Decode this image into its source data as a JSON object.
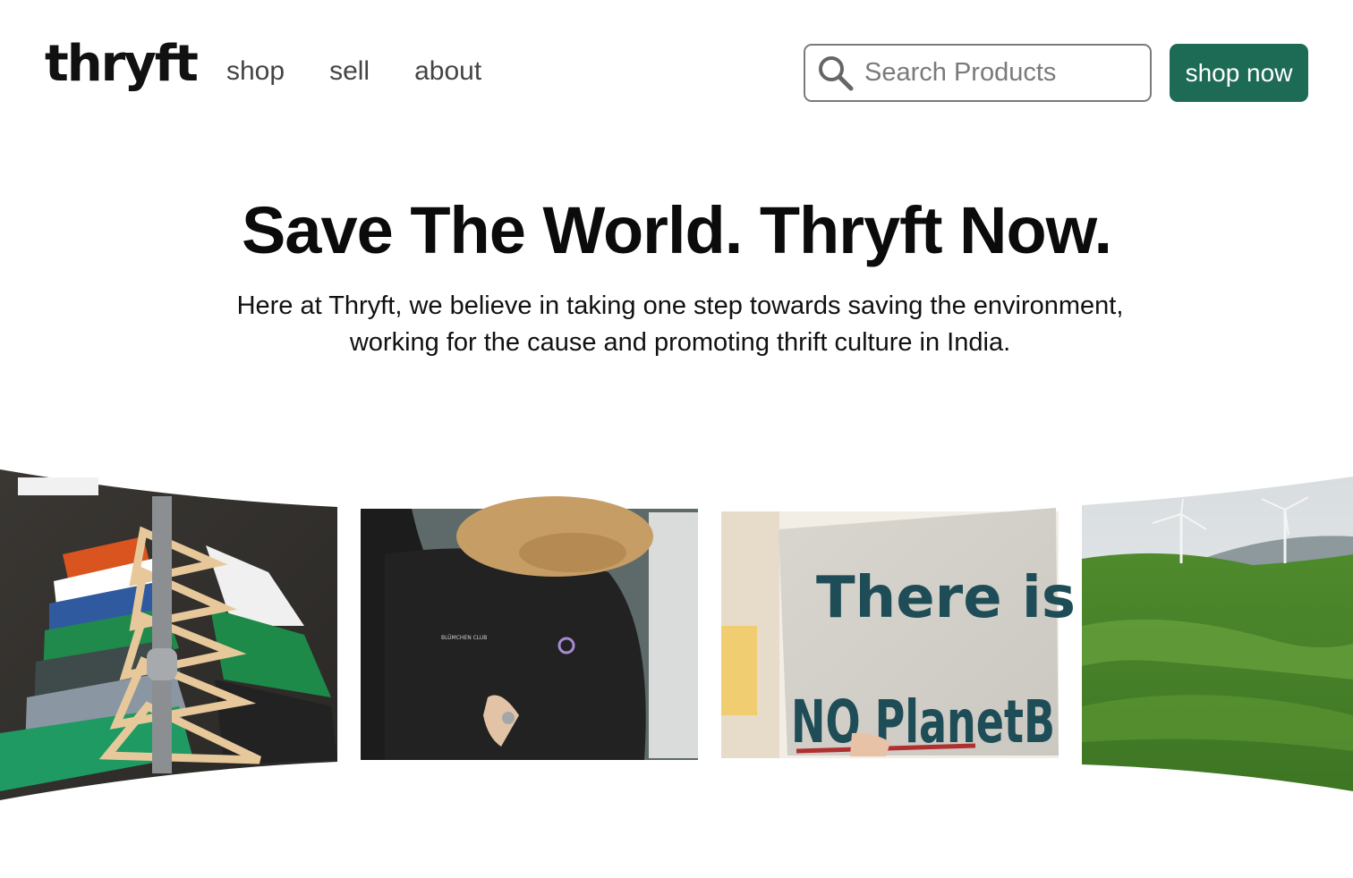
{
  "header": {
    "logo": "thryft",
    "nav": [
      {
        "label": "shop"
      },
      {
        "label": "sell"
      },
      {
        "label": "about"
      }
    ],
    "search": {
      "placeholder": "Search Products",
      "value": ""
    },
    "cta_label": "shop now"
  },
  "hero": {
    "title": "Save The World. Thryft Now.",
    "subtitle_line1": "Here at Thryft, we believe in taking one step towards saving the environment,",
    "subtitle_line2": "working for the cause and promoting thrift culture in India."
  },
  "gallery": {
    "sign_line1": "There is",
    "sign_line2": "NO PlanetB",
    "shirt_print": "BLÜMCHEN CLUB"
  },
  "colors": {
    "brand": "#1e6b55",
    "text": "#111111",
    "nav_text": "#444444",
    "search_border": "#7a7a7a"
  }
}
